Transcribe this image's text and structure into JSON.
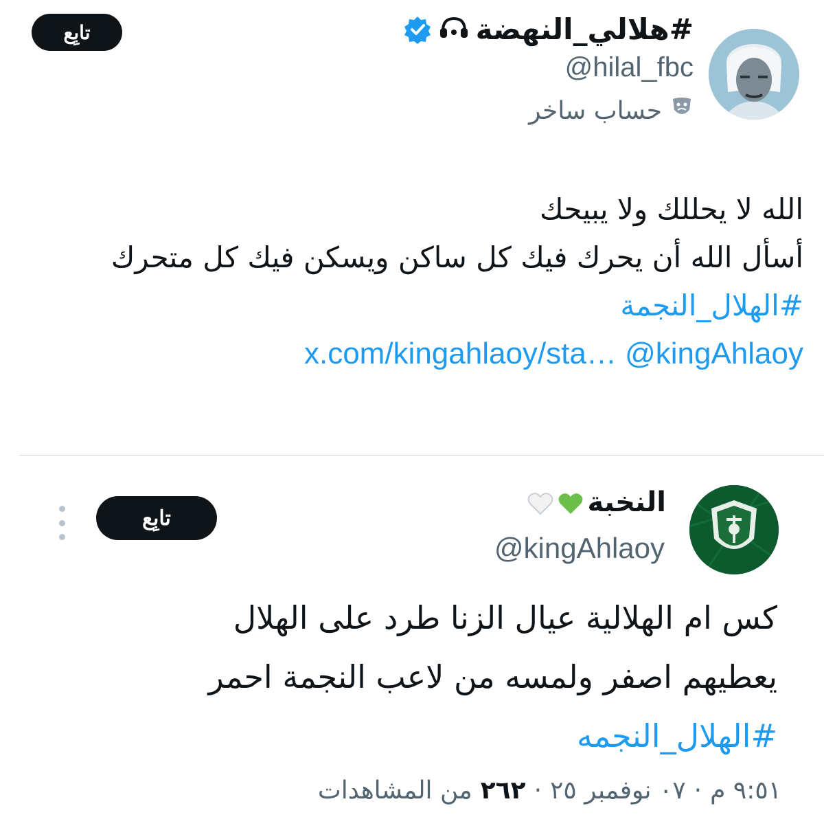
{
  "main_tweet": {
    "display_name": "#هلالي_النهضة",
    "handle": "@hilal_fbc",
    "parody_label": "حساب ساخر",
    "follow_label": "تابِع",
    "lines": [
      "الله لا يحللك ولا يبيحك",
      "أسأل الله أن يحرك فيك كل ساكن ويسكن فيك كل متحرك"
    ],
    "hashtag": "#الهلال_النجمة",
    "mention": "@kingAhlaoy",
    "link": "x.com/kingahlaoy/sta…",
    "accent_color": "#1d9bf0"
  },
  "quoted_tweet": {
    "display_name": "النخبة",
    "handle": "@kingAhlaoy",
    "follow_label": "تابِع",
    "lines": [
      "كس ام الهلالية عيال الزنا طرد على الهلال",
      "يعطيهم اصفر ولمسه من لاعب النجمة احمر"
    ],
    "hashtag": "#الهلال_النجمه",
    "time": "٩:٥١ م",
    "date": "٠٧ نوفمبر ٢٥",
    "views_count": "٢٦٢",
    "views_label": "من المشاهدات"
  },
  "icons": {
    "verified": "verified-badge-icon",
    "parody": "theater-mask-icon",
    "hearts": [
      "green-heart-icon",
      "white-heart-icon"
    ],
    "more": "more-vertical-icon"
  }
}
